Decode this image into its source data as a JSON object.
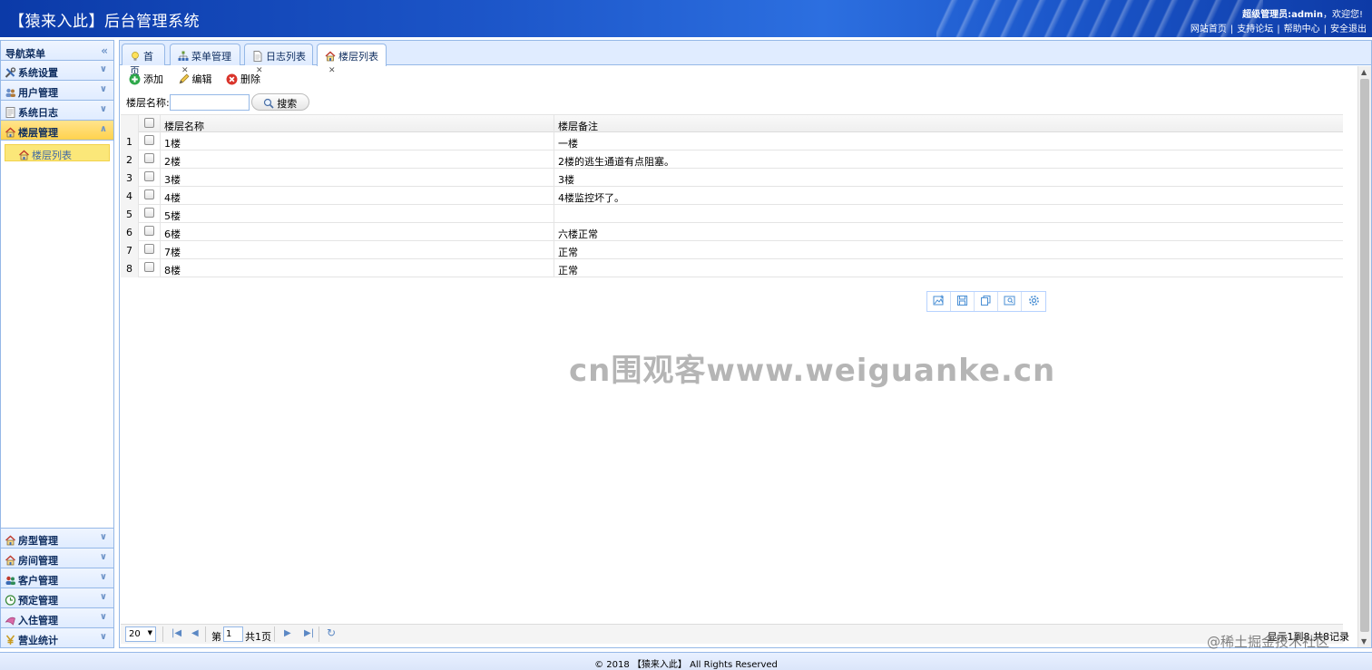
{
  "header": {
    "title": "【猿来入此】后台管理系统",
    "welcome_user": "超级管理员:admin",
    "welcome_suffix": "，欢迎您!",
    "links": [
      "网站首页",
      "支持论坛",
      "帮助中心",
      "安全退出"
    ]
  },
  "nav": {
    "title": "导航菜单",
    "collapse_icon": "«",
    "menus_top": [
      {
        "label": "系统设置",
        "icon": "tools-icon",
        "arrow": "expand"
      },
      {
        "label": "用户管理",
        "icon": "users-icon",
        "arrow": "expand"
      },
      {
        "label": "系统日志",
        "icon": "log-icon",
        "arrow": "expand"
      },
      {
        "label": "楼层管理",
        "icon": "house-icon",
        "arrow": "collapse",
        "active": true
      }
    ],
    "sub_items": [
      {
        "label": "楼层列表",
        "icon": "house-icon"
      }
    ],
    "menus_bottom": [
      {
        "label": "房型管理",
        "icon": "house-icon"
      },
      {
        "label": "房间管理",
        "icon": "house-icon"
      },
      {
        "label": "客户管理",
        "icon": "customers-icon"
      },
      {
        "label": "预定管理",
        "icon": "clock-icon"
      },
      {
        "label": "入住管理",
        "icon": "checkin-icon"
      },
      {
        "label": "营业统计",
        "icon": "yen-icon"
      }
    ]
  },
  "tabs": [
    {
      "label": "首页",
      "icon": "bulb-icon",
      "closable": false
    },
    {
      "label": "菜单管理",
      "icon": "tree-icon",
      "closable": true
    },
    {
      "label": "日志列表",
      "icon": "doc-icon",
      "closable": true
    },
    {
      "label": "楼层列表",
      "icon": "house-icon",
      "closable": true,
      "active": true
    }
  ],
  "toolbar": {
    "add_label": "添加",
    "edit_label": "编辑",
    "delete_label": "删除"
  },
  "search": {
    "label": "楼层名称:",
    "value": "",
    "button_label": "搜索"
  },
  "grid": {
    "columns": [
      "楼层名称",
      "楼层备注"
    ],
    "rows": [
      {
        "num": "1",
        "name": "1楼",
        "note": "一楼"
      },
      {
        "num": "2",
        "name": "2楼",
        "note": "2楼的逃生通道有点阻塞。"
      },
      {
        "num": "3",
        "name": "3楼",
        "note": "3楼"
      },
      {
        "num": "4",
        "name": "4楼",
        "note": "4楼监控坏了。"
      },
      {
        "num": "5",
        "name": "5楼",
        "note": ""
      },
      {
        "num": "6",
        "name": "6楼",
        "note": "六楼正常"
      },
      {
        "num": "7",
        "name": "7楼",
        "note": "正常"
      },
      {
        "num": "8",
        "name": "8楼",
        "note": "正常"
      }
    ]
  },
  "watermark": "cn围观客www.weiguanke.cn",
  "pager": {
    "page_size": "20",
    "page_prefix": "第",
    "page_value": "1",
    "page_total": "共1页",
    "info": "显示1到8,共8记录"
  },
  "juejin": "@稀土掘金技术社区",
  "footer": "© 2018 【猿来入此】 All Rights Reserved",
  "colors": {
    "accent": "#95b8e7",
    "active_menu": "#ffd24d",
    "header": "#1c55c8"
  }
}
